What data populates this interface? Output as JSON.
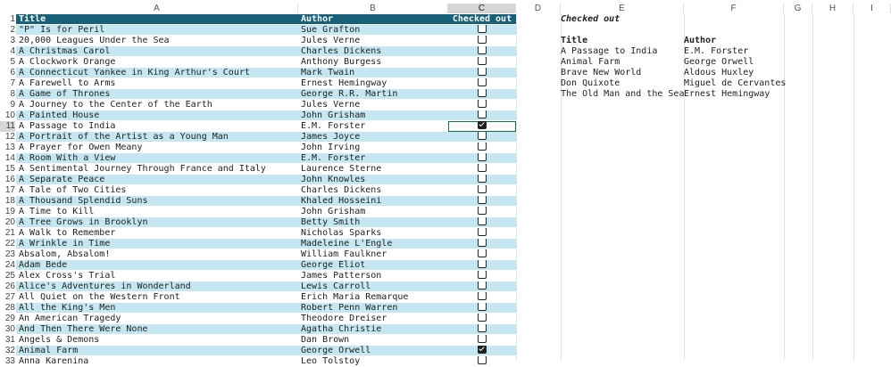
{
  "columns": [
    "A",
    "B",
    "C",
    "D",
    "E",
    "F",
    "G",
    "H",
    "I"
  ],
  "header": {
    "title": "Title",
    "author": "Author",
    "checked": "Checked out"
  },
  "rows": [
    {
      "n": "2",
      "title": "\"P\" Is for Peril",
      "author": "Sue Grafton",
      "checked": false
    },
    {
      "n": "3",
      "title": "20,000 Leagues Under the Sea",
      "author": "Jules Verne",
      "checked": false
    },
    {
      "n": "4",
      "title": "A Christmas Carol",
      "author": "Charles Dickens",
      "checked": false
    },
    {
      "n": "5",
      "title": "A Clockwork Orange",
      "author": "Anthony Burgess",
      "checked": false
    },
    {
      "n": "6",
      "title": "A Connecticut Yankee in King Arthur's Court",
      "author": "Mark Twain",
      "checked": false
    },
    {
      "n": "7",
      "title": "A Farewell to Arms",
      "author": "Ernest Hemingway",
      "checked": false
    },
    {
      "n": "8",
      "title": "A Game of Thrones",
      "author": "George R.R. Martin",
      "checked": false
    },
    {
      "n": "9",
      "title": "A Journey to the Center of the Earth",
      "author": "Jules Verne",
      "checked": false
    },
    {
      "n": "10",
      "title": "A Painted House",
      "author": "John Grisham",
      "checked": false
    },
    {
      "n": "11",
      "title": "A Passage to India",
      "author": "E.M. Forster",
      "checked": true
    },
    {
      "n": "12",
      "title": "A Portrait of the Artist as a Young Man",
      "author": "James Joyce",
      "checked": false
    },
    {
      "n": "13",
      "title": "A Prayer for Owen Meany",
      "author": "John Irving",
      "checked": false
    },
    {
      "n": "14",
      "title": "A Room With a View",
      "author": "E.M. Forster",
      "checked": false
    },
    {
      "n": "15",
      "title": "A Sentimental Journey Through France and Italy",
      "author": "Laurence Sterne",
      "checked": false
    },
    {
      "n": "16",
      "title": "A Separate Peace",
      "author": "John Knowles",
      "checked": false
    },
    {
      "n": "17",
      "title": "A Tale of Two Cities",
      "author": "Charles Dickens",
      "checked": false
    },
    {
      "n": "18",
      "title": "A Thousand Splendid Suns",
      "author": "Khaled Hosseini",
      "checked": false
    },
    {
      "n": "19",
      "title": "A Time to Kill",
      "author": "John Grisham",
      "checked": false
    },
    {
      "n": "20",
      "title": "A Tree Grows in Brooklyn",
      "author": "Betty Smith",
      "checked": false
    },
    {
      "n": "21",
      "title": "A Walk to Remember",
      "author": "Nicholas Sparks",
      "checked": false
    },
    {
      "n": "22",
      "title": "A Wrinkle in Time",
      "author": "Madeleine L'Engle",
      "checked": false
    },
    {
      "n": "23",
      "title": "Absalom, Absalom!",
      "author": "William Faulkner",
      "checked": false
    },
    {
      "n": "24",
      "title": "Adam Bede",
      "author": "George Eliot",
      "checked": false
    },
    {
      "n": "25",
      "title": "Alex Cross's Trial",
      "author": "James Patterson",
      "checked": false
    },
    {
      "n": "26",
      "title": "Alice's Adventures in Wonderland",
      "author": "Lewis Carroll",
      "checked": false
    },
    {
      "n": "27",
      "title": "All Quiet on the Western Front",
      "author": "Erich Maria Remarque",
      "checked": false
    },
    {
      "n": "28",
      "title": "All the King's Men",
      "author": "Robert Penn Warren",
      "checked": false
    },
    {
      "n": "29",
      "title": "An American Tragedy",
      "author": "Theodore Dreiser",
      "checked": false
    },
    {
      "n": "30",
      "title": "And Then There Were None",
      "author": "Agatha Christie",
      "checked": false
    },
    {
      "n": "31",
      "title": "Angels & Demons",
      "author": "Dan Brown",
      "checked": false
    },
    {
      "n": "32",
      "title": "Animal Farm",
      "author": "George Orwell",
      "checked": true
    },
    {
      "n": "33",
      "title": "Anna Karenina",
      "author": "Leo Tolstoy",
      "checked": false
    }
  ],
  "summary": {
    "heading": "Checked out",
    "col_title": "Title",
    "col_author": "Author",
    "items": [
      {
        "title": "A Passage to India",
        "author": "E.M. Forster"
      },
      {
        "title": "Animal Farm",
        "author": "George Orwell"
      },
      {
        "title": "Brave New World",
        "author": "Aldous Huxley"
      },
      {
        "title": "Don Quixote",
        "author": "Miguel de Cervantes"
      },
      {
        "title": "The Old Man and the Sea",
        "author": "Ernest Hemingway"
      }
    ]
  },
  "colors": {
    "header_bg": "#17607a",
    "band": "#c4e7f2",
    "selection": "#1e6f3d"
  }
}
